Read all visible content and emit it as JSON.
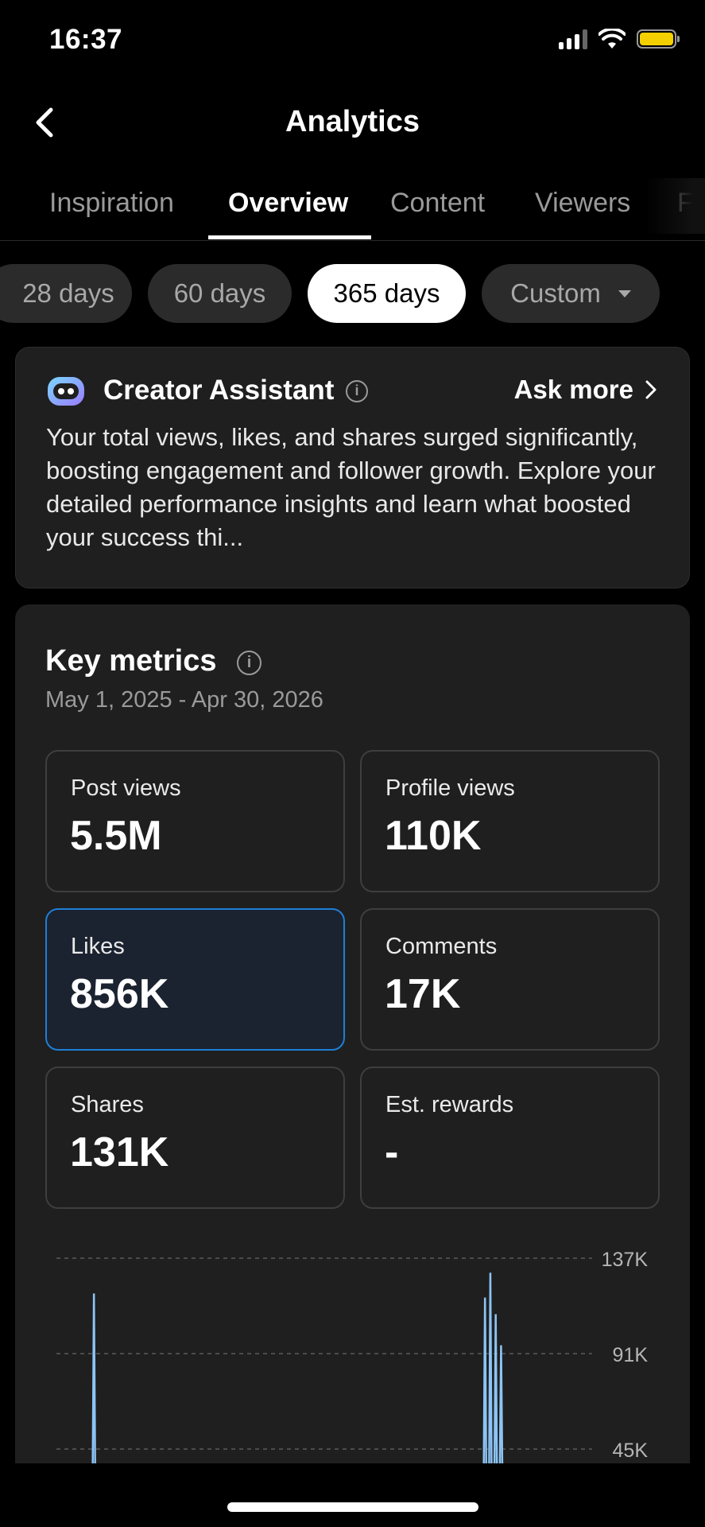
{
  "status_bar": {
    "time": "16:37"
  },
  "header": {
    "title": "Analytics"
  },
  "tabs": [
    {
      "label": "Inspiration"
    },
    {
      "label": "Overview",
      "active": true
    },
    {
      "label": "Content"
    },
    {
      "label": "Viewers"
    },
    {
      "label": "Fo"
    }
  ],
  "periods": [
    {
      "label": "28 days"
    },
    {
      "label": "60 days"
    },
    {
      "label": "365 days",
      "active": true
    },
    {
      "label": "Custom"
    }
  ],
  "assistant": {
    "title": "Creator Assistant",
    "ask_more": "Ask more",
    "text": "Your total views, likes, and shares surged significantly, boosting engagement and follower growth. Explore your detailed performance insights and learn what boosted your success thi..."
  },
  "key_metrics": {
    "title": "Key metrics",
    "date_range": "May 1, 2025 - Apr 30, 2026",
    "tiles": [
      {
        "label": "Post views",
        "value": "5.5M"
      },
      {
        "label": "Profile views",
        "value": "110K"
      },
      {
        "label": "Likes",
        "value": "856K",
        "selected": true
      },
      {
        "label": "Comments",
        "value": "17K"
      },
      {
        "label": "Shares",
        "value": "131K"
      },
      {
        "label": "Est. rewards",
        "value": "-"
      }
    ]
  },
  "chart_data": {
    "type": "line",
    "series_metric": "Likes",
    "y_ticks": [
      "137K",
      "91K",
      "45K"
    ],
    "ylim": [
      45000,
      137000
    ],
    "color": "#8cc4f5",
    "visible_peaks": [
      {
        "position": 0.07,
        "value": 120000
      },
      {
        "position": 0.8,
        "value": 118000
      },
      {
        "position": 0.81,
        "value": 130000
      },
      {
        "position": 0.82,
        "value": 110000
      },
      {
        "position": 0.83,
        "value": 95000
      }
    ]
  },
  "colors": {
    "accent": "#1f7fd6",
    "battery": "#f5d000",
    "card": "#1f1f1f"
  }
}
